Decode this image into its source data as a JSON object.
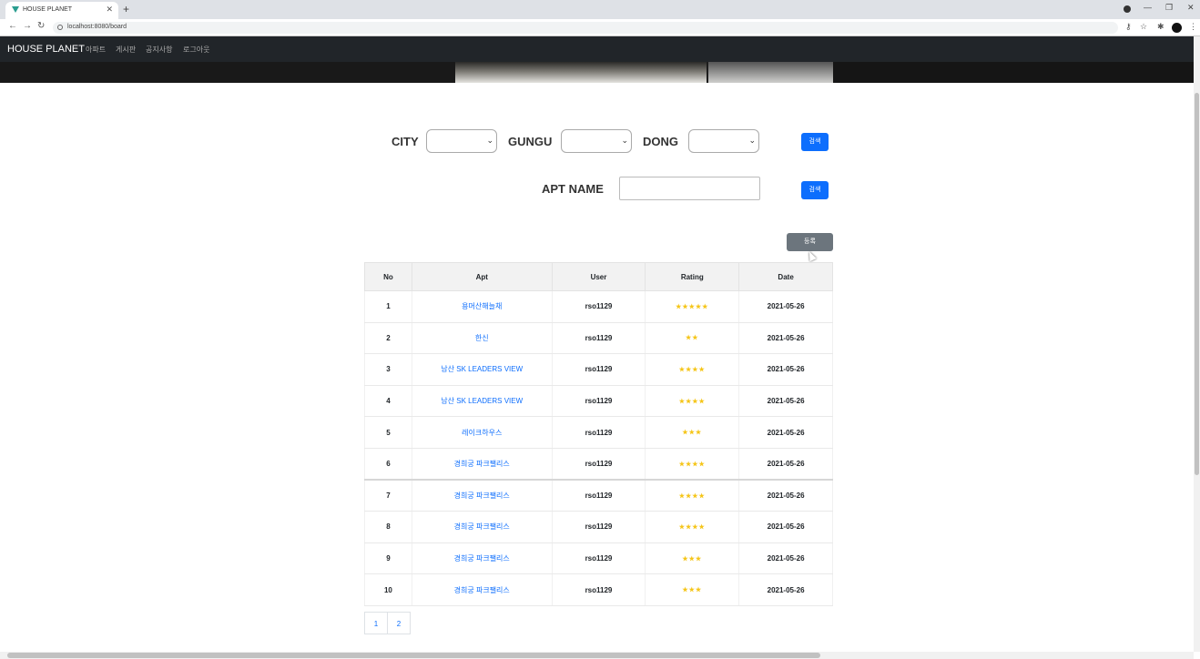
{
  "browser": {
    "tab_title": "HOUSE PLANET",
    "tab_close": "✕",
    "new_tab": "+",
    "url": "localhost:8080/board",
    "nav": {
      "back": "←",
      "forward": "→",
      "reload": "↻"
    },
    "window": {
      "minimize": "—",
      "restore": "❐",
      "close": "✕"
    },
    "right_icons": {
      "key": "⚷",
      "star": "☆",
      "puzzle": "✱",
      "menu": "⋮"
    }
  },
  "navbar": {
    "brand": "HOUSE PLANET",
    "links": [
      "아파트",
      "게시판",
      "공지사항",
      "로그아웃"
    ]
  },
  "search": {
    "city_label": "CITY",
    "gungu_label": "GUNGU",
    "dong_label": "DONG",
    "search_button": "검색",
    "apt_name_label": "APT NAME",
    "apt_name_value": "",
    "apt_search_button": "검색",
    "caret": "⌄"
  },
  "register_button": "등록",
  "table": {
    "headers": [
      "No",
      "Apt",
      "User",
      "Rating",
      "Date"
    ],
    "rows": [
      {
        "no": "1",
        "apt": "용머산해늘채",
        "user": "rso1129",
        "rating": "★★★★★",
        "date": "2021-05-26"
      },
      {
        "no": "2",
        "apt": "한신",
        "user": "rso1129",
        "rating": "★★",
        "date": "2021-05-26"
      },
      {
        "no": "3",
        "apt": "남산 SK LEADERS VIEW",
        "user": "rso1129",
        "rating": "★★★★",
        "date": "2021-05-26"
      },
      {
        "no": "4",
        "apt": "남산 SK LEADERS VIEW",
        "user": "rso1129",
        "rating": "★★★★",
        "date": "2021-05-26"
      },
      {
        "no": "5",
        "apt": "레이크하우스",
        "user": "rso1129",
        "rating": "★★★",
        "date": "2021-05-26"
      },
      {
        "no": "6",
        "apt": "경희궁 파크팰리스",
        "user": "rso1129",
        "rating": "★★★★",
        "date": "2021-05-26"
      },
      {
        "no": "7",
        "apt": "경희궁 파크팰리스",
        "user": "rso1129",
        "rating": "★★★★",
        "date": "2021-05-26"
      },
      {
        "no": "8",
        "apt": "경희궁 파크팰리스",
        "user": "rso1129",
        "rating": "★★★★",
        "date": "2021-05-26"
      },
      {
        "no": "9",
        "apt": "경희궁 파크팰리스",
        "user": "rso1129",
        "rating": "★★★",
        "date": "2021-05-26"
      },
      {
        "no": "10",
        "apt": "경희궁 파크팰리스",
        "user": "rso1129",
        "rating": "★★★",
        "date": "2021-05-26"
      }
    ]
  },
  "pagination": [
    "1",
    "2"
  ],
  "colors": {
    "navbar": "#212529",
    "primary": "#0d6efd",
    "secondary": "#6c757d",
    "star": "#f5c518"
  }
}
